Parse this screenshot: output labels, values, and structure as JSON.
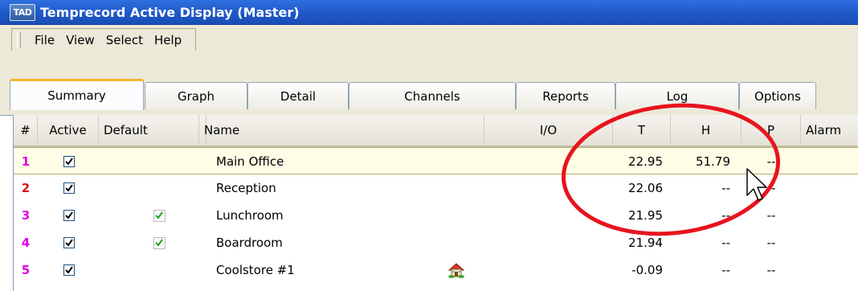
{
  "window": {
    "logo": "TAD",
    "title": "Temprecord Active Display (Master)"
  },
  "menu": [
    "File",
    "View",
    "Select",
    "Help"
  ],
  "tabs": [
    "Summary",
    "Graph",
    "Detail",
    "Channels",
    "Reports",
    "Log",
    "Options"
  ],
  "active_tab": "Summary",
  "columns": [
    "#",
    "Active",
    "Default",
    "Name",
    "I/O",
    "T",
    "H",
    "P",
    "Alarm"
  ],
  "rows": [
    {
      "num": "1",
      "num_color": "#e000e0",
      "active": true,
      "default": false,
      "name": "Main Office",
      "io_icon": null,
      "t": "22.95",
      "h": "51.79",
      "p": "--",
      "selected": true
    },
    {
      "num": "2",
      "num_color": "#e01010",
      "active": true,
      "default": false,
      "name": "Reception",
      "io_icon": null,
      "t": "22.06",
      "h": "--",
      "p": "--",
      "selected": false
    },
    {
      "num": "3",
      "num_color": "#e000e0",
      "active": true,
      "default": true,
      "name": "Lunchroom",
      "io_icon": null,
      "t": "21.95",
      "h": "--",
      "p": "--",
      "selected": false
    },
    {
      "num": "4",
      "num_color": "#e000e0",
      "active": true,
      "default": true,
      "name": "Boardroom",
      "io_icon": null,
      "t": "21.94",
      "h": "--",
      "p": "--",
      "selected": false
    },
    {
      "num": "5",
      "num_color": "#e000e0",
      "active": true,
      "default": false,
      "name": "Coolstore #1",
      "io_icon": "house-icon",
      "t": "-0.09",
      "h": "--",
      "p": "--",
      "selected": false
    }
  ],
  "colors": {
    "titlebar": "#1f58c7",
    "chrome": "#ece9d8",
    "tab_highlight": "#f7b530",
    "annotation": "#e8141e"
  }
}
